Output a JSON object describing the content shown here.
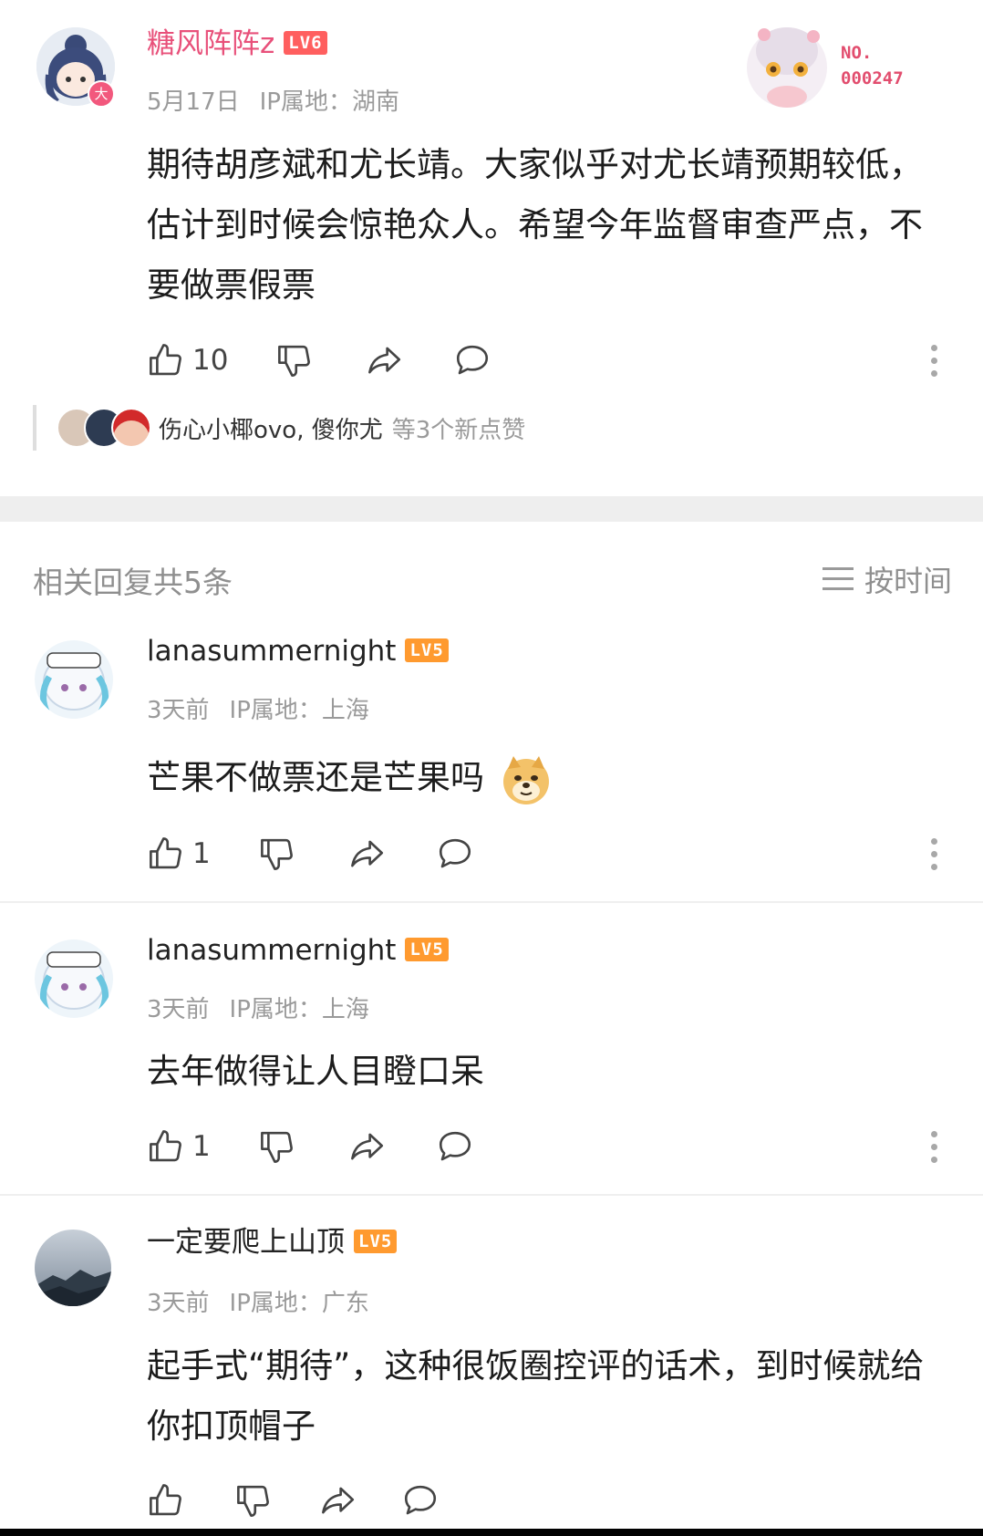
{
  "top_comment": {
    "username": "糖风阵阵z",
    "level": "LV6",
    "date": "5月17日",
    "ip": "IP属地：湖南",
    "text": "期待胡彦斌和尤长靖。大家似乎对尤长靖预期较低，估计到时候会惊艳众人。希望今年监督审查严点，不要做票假票",
    "like_count": "10",
    "badge": {
      "line1": "NO.",
      "line2": "000247"
    },
    "likers": {
      "names": "伤心小椰ovo, 傻你尤",
      "more": "等3个新点赞"
    }
  },
  "replies_header": {
    "title": "相关回复共5条",
    "sort_label": "按时间"
  },
  "replies": [
    {
      "username": "lanasummernight",
      "level": "LV5",
      "date": "3天前",
      "ip": "IP属地：上海",
      "text": "芒果不做票还是芒果吗",
      "like_count": "1"
    },
    {
      "username": "lanasummernight",
      "level": "LV5",
      "date": "3天前",
      "ip": "IP属地：上海",
      "text": "去年做得让人目瞪口呆",
      "like_count": "1"
    },
    {
      "username": "一定要爬上山顶",
      "level": "LV5",
      "date": "3天前",
      "ip": "IP属地：广东",
      "text": "起手式“期待”，这种很饭圈控评的话术，到时候就给你扣顶帽子",
      "like_count": ""
    }
  ],
  "colors": {
    "username_pink": "#e8507a",
    "lv6": "#ff5f5f",
    "lv5": "#ff9a2f",
    "meta_gray": "#9a9a9a"
  }
}
